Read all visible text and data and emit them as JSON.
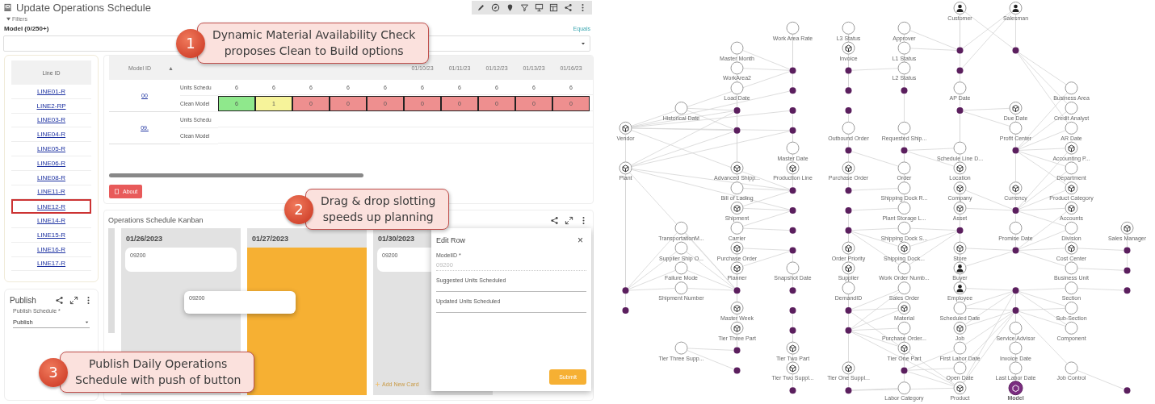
{
  "app": {
    "title": "Update Operations Schedule",
    "filters_toggle": "Filters",
    "filter": {
      "label": "Model (0/250+)",
      "operator": "Equals"
    },
    "line_list": {
      "header": "Line ID",
      "items": [
        {
          "label": "LINE01-R",
          "selected": false
        },
        {
          "label": "LINE2-RP",
          "selected": false
        },
        {
          "label": "LINE03-R",
          "selected": false
        },
        {
          "label": "LINE04-R",
          "selected": false
        },
        {
          "label": "LINE05-R",
          "selected": false
        },
        {
          "label": "LINE06-R",
          "selected": false
        },
        {
          "label": "LINE08-R",
          "selected": false
        },
        {
          "label": "LINE11-R",
          "selected": false
        },
        {
          "label": "LINE12-R",
          "selected": true
        },
        {
          "label": "LINE14-R",
          "selected": false
        },
        {
          "label": "LINE15-R",
          "selected": false
        },
        {
          "label": "LINE16-R",
          "selected": false
        },
        {
          "label": "LINE17-R",
          "selected": false
        }
      ]
    },
    "grid": {
      "model_header": "Model ID",
      "sort_indicator": "▲",
      "date_columns": [
        "01/10/23",
        "01/11/23",
        "01/12/23",
        "01/13/23",
        "01/16/23"
      ],
      "models": [
        {
          "model": "00",
          "rows": [
            {
              "label": "Units Schedu",
              "cells": [
                {
                  "text": "6"
                },
                {
                  "text": "6"
                },
                {
                  "text": "6"
                },
                {
                  "text": "6"
                },
                {
                  "text": "6"
                },
                {
                  "text": "6"
                },
                {
                  "text": "6"
                },
                {
                  "text": "6"
                },
                {
                  "text": "6"
                },
                {
                  "text": "6"
                }
              ]
            },
            {
              "label": "Clean Model",
              "cells": [
                {
                  "text": "6",
                  "color": "#8fe88c"
                },
                {
                  "text": "1",
                  "color": "#f6f39a"
                },
                {
                  "text": "0",
                  "color": "#ee8f8f"
                },
                {
                  "text": "0",
                  "color": "#ee8f8f"
                },
                {
                  "text": "0",
                  "color": "#ee8f8f"
                },
                {
                  "text": "0",
                  "color": "#ee8f8f"
                },
                {
                  "text": "0",
                  "color": "#ee8f8f"
                },
                {
                  "text": "0",
                  "color": "#ee8f8f"
                },
                {
                  "text": "0",
                  "color": "#ee8f8f"
                },
                {
                  "text": "0",
                  "color": "#ee8f8f"
                }
              ]
            }
          ]
        },
        {
          "model": "09.",
          "rows": [
            {
              "label": "Units Schedu"
            },
            {
              "label": "Clean Model"
            }
          ]
        }
      ]
    },
    "about_button": "About",
    "kanban": {
      "title": "Operations Schedule Kanban",
      "columns": [
        {
          "date": "01/26/2023",
          "highlighted": false,
          "cards": [
            "09200"
          ]
        },
        {
          "date": "01/27/2023",
          "highlighted": true
        },
        {
          "date": "01/30/2023",
          "highlighted": false,
          "cards": [
            "09200"
          ],
          "add_card": "Add New Card"
        }
      ],
      "dragged_card": "09200"
    },
    "edit_dialog": {
      "title": "Edit Row",
      "close": "×",
      "fields": [
        {
          "label": "ModelID *",
          "value": "09200",
          "disabled": true
        },
        {
          "label": "Suggested Units Scheduled",
          "disabled": false
        },
        {
          "label": "Updated Units Scheduled",
          "disabled": false
        }
      ],
      "submit": "Submit"
    },
    "publish": {
      "title": "Publish",
      "field_label": "Publish Schedule *",
      "value": "Publish"
    },
    "callouts": [
      {
        "number": "1",
        "lines": [
          "Dynamic Material Availability Check",
          "proposes Clean to Build options"
        ]
      },
      {
        "number": "2",
        "lines": [
          "Drag & drop slotting",
          "speeds up planning"
        ]
      },
      {
        "number": "3",
        "lines": [
          "Publish Daily Operations",
          "Schedule with push of button"
        ]
      }
    ]
  },
  "graph": {
    "nodes": [
      {
        "label": "Customer",
        "kind": "person"
      },
      {
        "label": "Salesman",
        "kind": "person"
      },
      {
        "label": "Work Area Rate",
        "kind": "plain"
      },
      {
        "label": "L3 Status",
        "kind": "plain"
      },
      {
        "label": "Approver",
        "kind": "plain"
      },
      {
        "label": "Master Month",
        "kind": "plain"
      },
      {
        "label": "Invoice",
        "kind": "icon"
      },
      {
        "label": "L1 Status",
        "kind": "plain"
      },
      {
        "label": "WorkArea2",
        "kind": "plain"
      },
      {
        "label": "L2 Status",
        "kind": "plain"
      },
      {
        "label": "Load Date",
        "kind": "plain"
      },
      {
        "label": "AP Date",
        "kind": "plain"
      },
      {
        "label": "Business Area",
        "kind": "plain"
      },
      {
        "label": "Historical Date",
        "kind": "plain"
      },
      {
        "label": "Due Date",
        "kind": "icon"
      },
      {
        "label": "Credit Analyst",
        "kind": "plain"
      },
      {
        "label": "Vendor",
        "kind": "icon"
      },
      {
        "label": "Outbound Order",
        "kind": "plain"
      },
      {
        "label": "Requested Ship...",
        "kind": "plain"
      },
      {
        "label": "Profit Center",
        "kind": "plain"
      },
      {
        "label": "AR Date",
        "kind": "plain"
      },
      {
        "label": "Master Date",
        "kind": "plain"
      },
      {
        "label": "Schedule Line D...",
        "kind": "plain"
      },
      {
        "label": "Accounting P...",
        "kind": "icon"
      },
      {
        "label": "Plant",
        "kind": "icon"
      },
      {
        "label": "Advanced Shipp...",
        "kind": "icon"
      },
      {
        "label": "Production Line",
        "kind": "icon"
      },
      {
        "label": "Purchase Order",
        "kind": "icon"
      },
      {
        "label": "Order",
        "kind": "plain"
      },
      {
        "label": "Location",
        "kind": "icon"
      },
      {
        "label": "Department",
        "kind": "plain"
      },
      {
        "label": "Bill of Lading",
        "kind": "plain"
      },
      {
        "label": "Shipping Dock R...",
        "kind": "plain"
      },
      {
        "label": "Company",
        "kind": "icon"
      },
      {
        "label": "Currency",
        "kind": "icon"
      },
      {
        "label": "Product Category",
        "kind": "icon"
      },
      {
        "label": "Shipment",
        "kind": "icon"
      },
      {
        "label": "Plant Storage L...",
        "kind": "plain"
      },
      {
        "label": "Asset",
        "kind": "icon"
      },
      {
        "label": "Accounts",
        "kind": "icon"
      },
      {
        "label": "TransportationM...",
        "kind": "plain"
      },
      {
        "label": "Carrier",
        "kind": "plain"
      },
      {
        "label": "Shipping Dock S...",
        "kind": "plain"
      },
      {
        "label": "Promise Date",
        "kind": "plain"
      },
      {
        "label": "Division",
        "kind": "plain"
      },
      {
        "label": "Sales Manager",
        "kind": "icon"
      },
      {
        "label": "Supplier Ship O...",
        "kind": "plain"
      },
      {
        "label": "Purchase Order",
        "kind": "icon"
      },
      {
        "label": "Order Priority",
        "kind": "icon"
      },
      {
        "label": "Shipping Dock...",
        "kind": "icon"
      },
      {
        "label": "Store",
        "kind": "icon"
      },
      {
        "label": "Cost Center",
        "kind": "icon"
      },
      {
        "label": "Failure Mode",
        "kind": "plain"
      },
      {
        "label": "Planner",
        "kind": "icon"
      },
      {
        "label": "Snapshot Date",
        "kind": "plain"
      },
      {
        "label": "Supplier",
        "kind": "icon"
      },
      {
        "label": "Work Order Numb...",
        "kind": "plain"
      },
      {
        "label": "Buyer",
        "kind": "person"
      },
      {
        "label": "Business Unit",
        "kind": "plain"
      },
      {
        "label": "Shipment Number",
        "kind": "plain"
      },
      {
        "label": "DemandID",
        "kind": "plain"
      },
      {
        "label": "Sales Order",
        "kind": "plain"
      },
      {
        "label": "Employee",
        "kind": "person"
      },
      {
        "label": "Section",
        "kind": "plain"
      },
      {
        "label": "Master Week",
        "kind": "icon"
      },
      {
        "label": "Material",
        "kind": "icon"
      },
      {
        "label": "Scheduled Date",
        "kind": "plain"
      },
      {
        "label": "Sub-Section",
        "kind": "plain"
      },
      {
        "label": "Tier Three Part",
        "kind": "icon"
      },
      {
        "label": "Purchase Order...",
        "kind": "plain"
      },
      {
        "label": "Job",
        "kind": "icon"
      },
      {
        "label": "Service Advisor",
        "kind": "plain"
      },
      {
        "label": "Component",
        "kind": "plain"
      },
      {
        "label": "Tier Three Supp...",
        "kind": "plain"
      },
      {
        "label": "Tier Two Part",
        "kind": "icon"
      },
      {
        "label": "Tier One Part",
        "kind": "icon"
      },
      {
        "label": "First Labor Date",
        "kind": "plain"
      },
      {
        "label": "Invoice Date",
        "kind": "plain"
      },
      {
        "label": "Tier Two Suppl...",
        "kind": "icon"
      },
      {
        "label": "Tier One Suppl...",
        "kind": "icon"
      },
      {
        "label": "Open Date",
        "kind": "plain"
      },
      {
        "label": "Last Labor Date",
        "kind": "plain"
      },
      {
        "label": "Job Control",
        "kind": "plain"
      },
      {
        "label": "Labor Category",
        "kind": "plain"
      },
      {
        "label": "Product",
        "kind": "icon"
      },
      {
        "label": "Model",
        "kind": "highlight"
      }
    ]
  }
}
